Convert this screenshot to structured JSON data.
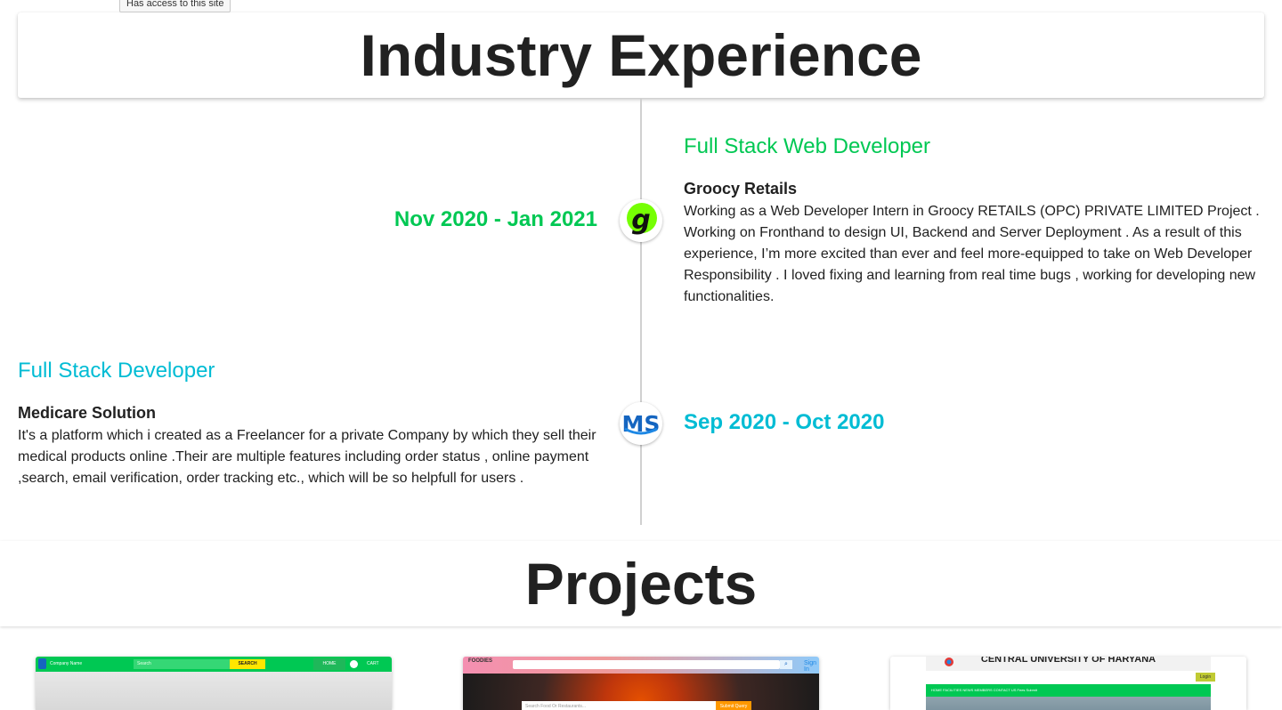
{
  "tooltip": {
    "text": "Has access to this site"
  },
  "experience": {
    "heading": "Industry Experience",
    "items": [
      {
        "role": "Full Stack Web Developer",
        "company": "Groocy Retails",
        "description": "Working as a Web Developer Intern in Groocy RETAILS (OPC) PRIVATE LIMITED Project . Working on Fronthand to design UI, Backend and Server Deployment . As a result of this experience, I’m more excited than ever and feel more-equipped to take on Web Developer Responsibility . I loved fixing and learning from real time bugs , working for developing new functionalities.",
        "date": "Nov 2020 - Jan 2021",
        "color": "#00c853",
        "logo": "groocy-g-logo"
      },
      {
        "role": "Full Stack Developer",
        "company": "Medicare Solution",
        "description": "It's a platform which i created as a Freelancer for a private Company by which they sell their medical products online .Their are multiple features including order status , online payment ,search, email verification, order tracking etc., which will be so helpfull for users .",
        "date": "Sep 2020 - Oct 2020",
        "color": "#00bcd4",
        "logo": "ms-logo"
      }
    ]
  },
  "projects": {
    "heading": "Projects",
    "thumbs": [
      {
        "brand": "Company Name",
        "search_placeholder": "Search",
        "search_button": "SEARCH",
        "nav_home": "HOME",
        "nav_cart": "CART"
      },
      {
        "brand": "FOODIES",
        "search_placeholder": "Search Food Or Restaurants...",
        "search_button": "Submit Query",
        "sign_in": "Sign In"
      },
      {
        "title": "CENTRAL UNIVERSITY OF HARYANA",
        "nav": "HOME   FACILITIES   NEWS   MEMBERS   CONTACT US   Fees Submit",
        "login": "Login"
      }
    ]
  }
}
